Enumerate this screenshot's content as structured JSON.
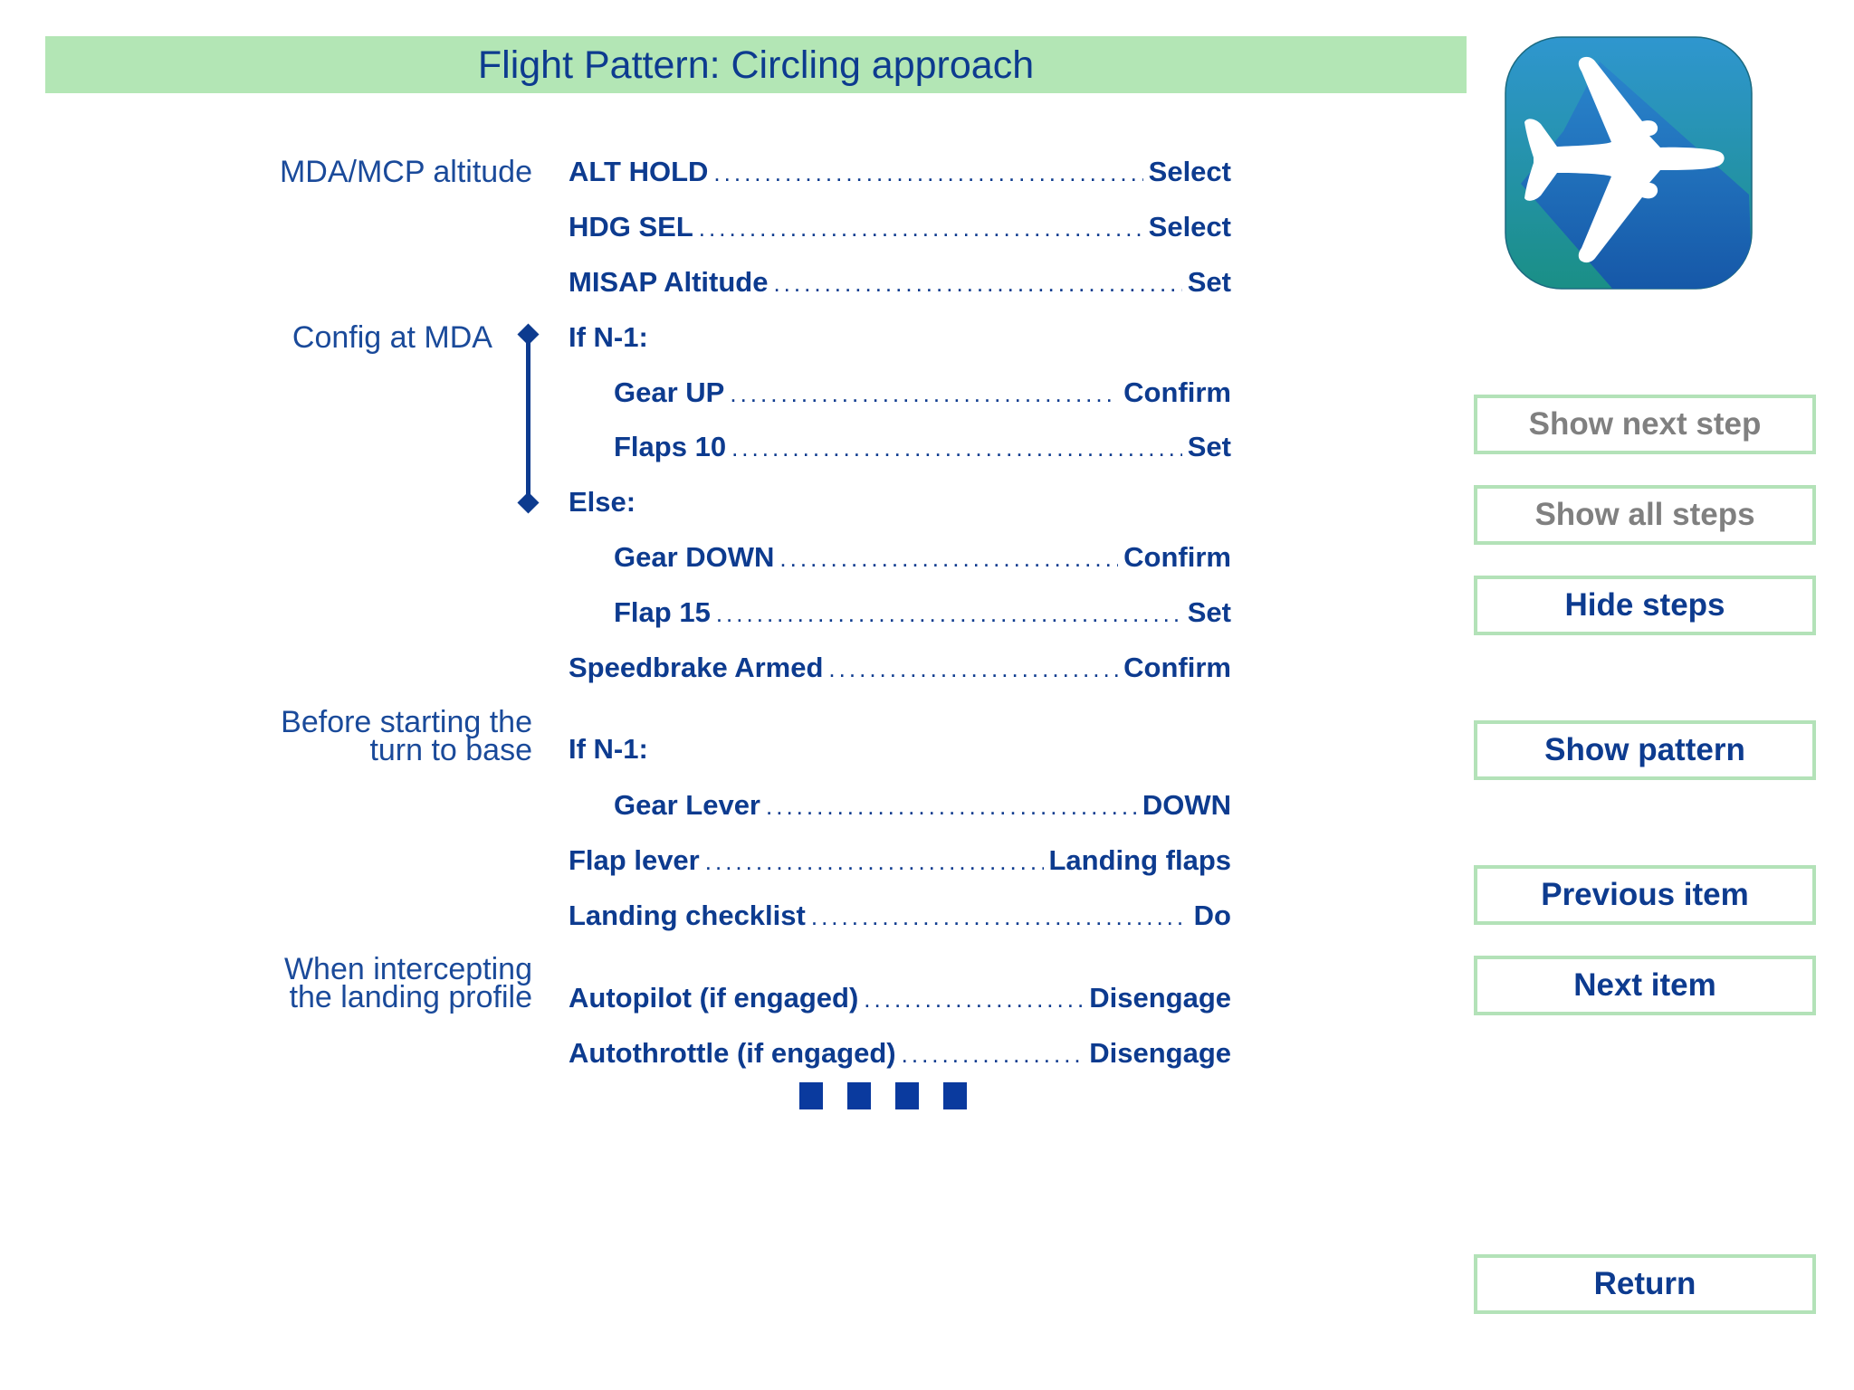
{
  "header": {
    "title": "Flight Pattern: Circling approach",
    "title_bar_color": "#b3e6b5",
    "text_color": "#0d3b8f"
  },
  "app_icon": {
    "semantic": "airplane-icon",
    "gradient_top": "#2f96cf",
    "gradient_bottom": "#1658a8",
    "shadow_color": "#1a8f86"
  },
  "sections": [
    {
      "label_lines": [
        "MDA/MCP altitude"
      ]
    },
    {
      "label_lines": [
        "Config at MDA"
      ]
    },
    {
      "label_lines": [
        "Before starting the",
        "turn to base"
      ]
    },
    {
      "label_lines": [
        "When intercepting",
        "the landing profile"
      ]
    }
  ],
  "checklist": [
    {
      "item": "ALT HOLD",
      "value": "Select",
      "indent": false
    },
    {
      "item": "HDG SEL",
      "value": "Select",
      "indent": false
    },
    {
      "item": "MISAP Altitude",
      "value": "Set",
      "indent": false
    },
    {
      "item": "If N-1:",
      "value": "",
      "indent": false,
      "heading": true
    },
    {
      "item": "Gear UP",
      "value": "Confirm",
      "indent": true
    },
    {
      "item": "Flaps 10",
      "value": "Set",
      "indent": true
    },
    {
      "item": "Else:",
      "value": "",
      "indent": false,
      "heading": true
    },
    {
      "item": "Gear DOWN",
      "value": "Confirm",
      "indent": true
    },
    {
      "item": "Flap 15",
      "value": "Set",
      "indent": true
    },
    {
      "item": "Speedbrake Armed",
      "value": "Confirm",
      "indent": false
    },
    {
      "item": "If N-1:",
      "value": "",
      "indent": false,
      "heading": true
    },
    {
      "item": "Gear Lever",
      "value": "DOWN",
      "indent": true
    },
    {
      "item": "Flap lever",
      "value": "Landing flaps",
      "indent": false
    },
    {
      "item": "Landing checklist",
      "value": "Do",
      "indent": false
    },
    {
      "item": "Autopilot (if engaged)",
      "value": "Disengage",
      "indent": false
    },
    {
      "item": "Autothrottle (if engaged)",
      "value": "Disengage",
      "indent": false
    }
  ],
  "continuation_indicator": {
    "semantic": "more-steps-indicator",
    "count": 4,
    "color": "#0a3a9e"
  },
  "buttons": {
    "show_next_step": {
      "label": "Show next step",
      "enabled": false
    },
    "show_all_steps": {
      "label": "Show all steps",
      "enabled": false
    },
    "hide_steps": {
      "label": "Hide steps",
      "enabled": true
    },
    "show_pattern": {
      "label": "Show pattern",
      "enabled": true
    },
    "previous_item": {
      "label": "Previous item",
      "enabled": true
    },
    "next_item": {
      "label": "Next item",
      "enabled": true
    },
    "return": {
      "label": "Return",
      "enabled": true
    },
    "border_color": "#b3e2b8",
    "disabled_text_color": "#808080"
  }
}
